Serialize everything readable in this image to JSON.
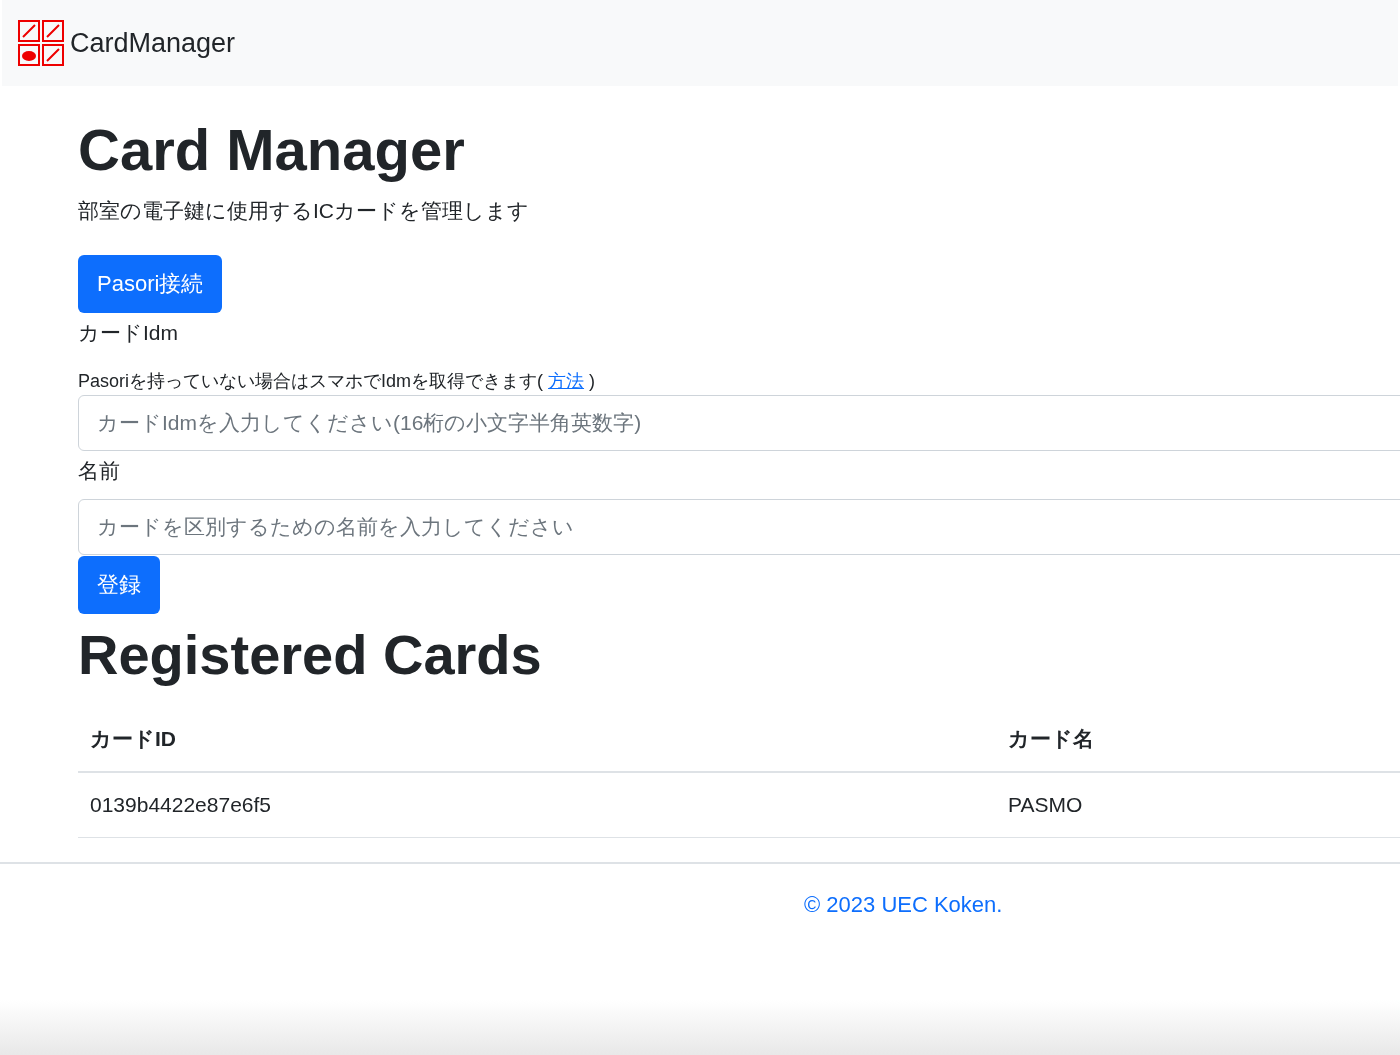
{
  "navbar": {
    "brand": "CardManager"
  },
  "header": {
    "title": "Card Manager",
    "description": "部室の電子鍵に使用するICカードを管理します"
  },
  "connect_button": "Pasori接続",
  "form": {
    "idm_label": "カードIdm",
    "idm_hint": "Pasoriを持っていない場合はスマホでIdmを取得できます(",
    "idm_hint_link": "方法",
    "idm_hint_end": ")",
    "idm_placeholder": "カードIdmを入力してください(16桁の小文字半角英数字)",
    "name_label": "名前",
    "name_placeholder": "カードを区別するための名前を入力してください",
    "submit": "登録"
  },
  "registered": {
    "title": "Registered Cards",
    "columns": [
      "カードID",
      "カード名"
    ],
    "rows": [
      [
        "0139b4422e87e6f5",
        "PASMO"
      ]
    ]
  },
  "footer": "© 2023 UEC Koken."
}
